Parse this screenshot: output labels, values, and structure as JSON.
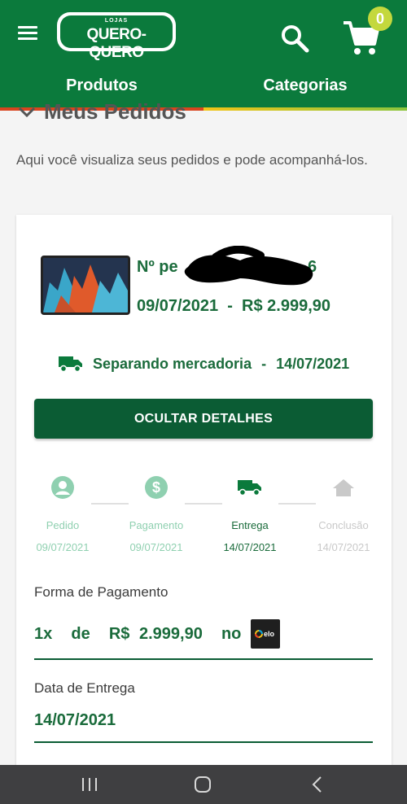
{
  "header": {
    "logo_top": "LOJAS",
    "logo_text": "QUERO-QUERO",
    "cart_count": "0",
    "tabs": [
      {
        "label": "Produtos"
      },
      {
        "label": "Categorias"
      }
    ]
  },
  "page": {
    "section_title": "Meus Pedidos",
    "intro": "Aqui você visualiza seus pedidos e pode acompanhá-los."
  },
  "order": {
    "number_prefix": "Nº pe",
    "number_suffix": "6",
    "date": "09/07/2021",
    "separator": "-",
    "total": "R$ 2.999,90",
    "status": "Separando mercadoria",
    "status_date": "14/07/2021",
    "details_button": "OCULTAR DETALHES"
  },
  "steps": [
    {
      "label": "Pedido",
      "date": "09/07/2021",
      "icon": "person-icon",
      "state": "done"
    },
    {
      "label": "Pagamento",
      "date": "09/07/2021",
      "icon": "dollar-icon",
      "state": "done"
    },
    {
      "label": "Entrega",
      "date": "14/07/2021",
      "icon": "truck-icon",
      "state": "current"
    },
    {
      "label": "Conclusão",
      "date": "14/07/2021",
      "icon": "home-icon",
      "state": "pending"
    }
  ],
  "payment": {
    "label": "Forma de Pagamento",
    "installments": "1x",
    "de": "de",
    "amount": "R$ 2.999,90",
    "no": "no",
    "card_brand": "elo"
  },
  "delivery": {
    "label": "Data de Entrega",
    "date": "14/07/2021"
  },
  "colors": {
    "header": "#0b7a3c",
    "primary_dark": "#0b5c34",
    "text_green": "#1a6b3b",
    "step_done": "#8fd0b0",
    "badge": "#c4d83d"
  }
}
